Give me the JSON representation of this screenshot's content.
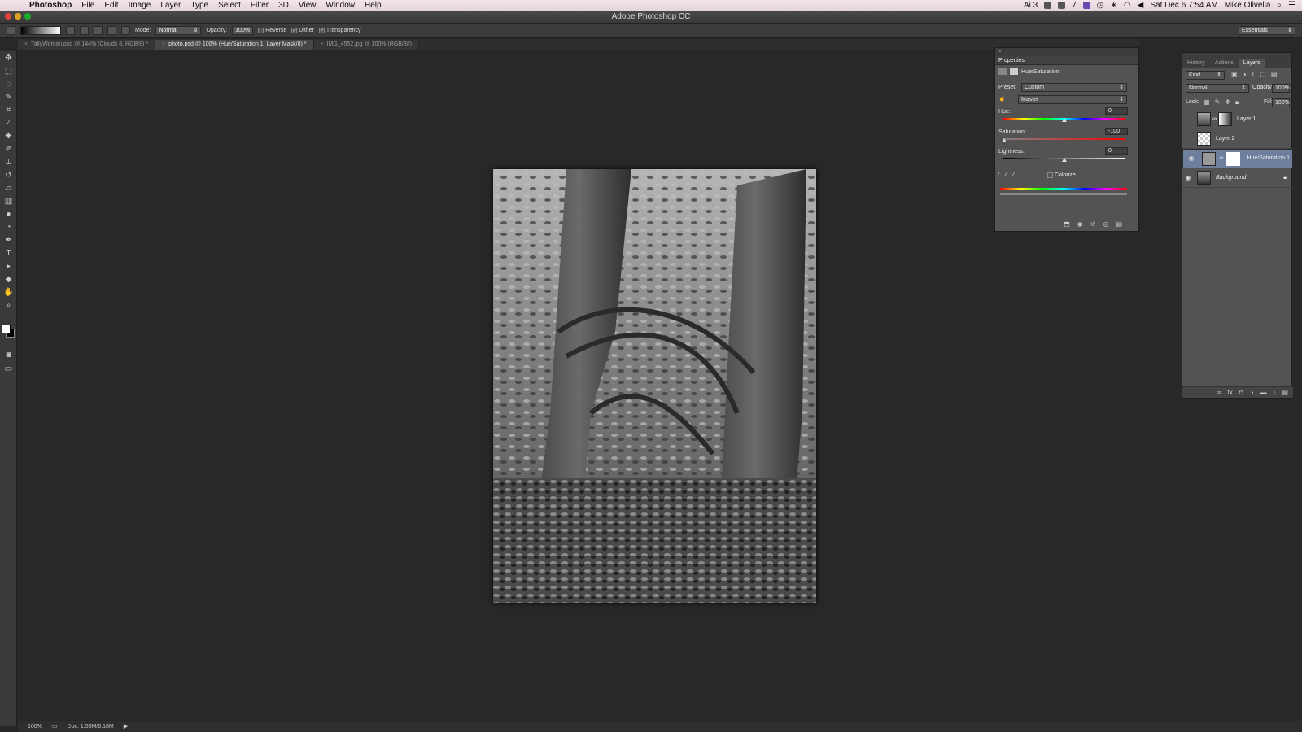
{
  "menubar": {
    "app": "Photoshop",
    "items": [
      "File",
      "Edit",
      "Image",
      "Layer",
      "Type",
      "Select",
      "Filter",
      "3D",
      "View",
      "Window",
      "Help"
    ],
    "status_ai": "3",
    "status_cc": "7",
    "clock": "Sat Dec 6  7:54 AM",
    "user": "Mike Olivella"
  },
  "window": {
    "title": "Adobe Photoshop CC"
  },
  "options": {
    "mode_label": "Mode:",
    "mode_value": "Normal",
    "opacity_label": "Opacity:",
    "opacity_value": "100%",
    "reverse": "Reverse",
    "dither": "Dither",
    "transparency": "Transparency",
    "workspace": "Essentials"
  },
  "tabs": [
    {
      "label": "TallyWoman.psd @ 144% (Clouds 8, RGB/8) *",
      "active": false
    },
    {
      "label": "photo.psd @ 100% (Hue/Saturation 1, Layer Mask/8) *",
      "active": true
    },
    {
      "label": "IMG_4552.jpg @ 100% (RGB/8#)",
      "active": false
    }
  ],
  "status": {
    "zoom": "100%",
    "doc": "Doc: 1.55M/6.18M"
  },
  "properties": {
    "panel_title": "Properties",
    "adjustment": "Hue/Saturation",
    "preset_label": "Preset:",
    "preset_value": "Custom",
    "channel": "Master",
    "hue_label": "Hue:",
    "hue_value": "0",
    "saturation_label": "Saturation:",
    "saturation_value": "-100",
    "lightness_label": "Lightness:",
    "lightness_value": "0",
    "colorize": "Colorize"
  },
  "layers_panel": {
    "tabs": [
      "History",
      "Actions",
      "Layers"
    ],
    "filter": "Kind",
    "blend": "Normal",
    "opacity_label": "Opacity:",
    "opacity_value": "100%",
    "lock_label": "Lock:",
    "fill_label": "Fill:",
    "fill_value": "100%",
    "layers": [
      {
        "name": "Layer 1",
        "visible": false
      },
      {
        "name": "Layer 2",
        "visible": false
      },
      {
        "name": "Hue/Saturation 1",
        "visible": true,
        "selected": true
      },
      {
        "name": "Background",
        "visible": true,
        "locked": true
      }
    ]
  },
  "colors": {
    "accent_selected_layer": "#6d7f9c",
    "canvas_bg": "#282828"
  }
}
